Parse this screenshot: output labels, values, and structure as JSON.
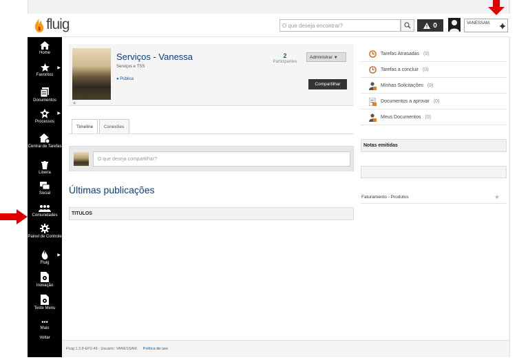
{
  "header": {
    "logo_text": "fluig",
    "search_placeholder": "O que deseja encontrar?",
    "notification_count": "0",
    "user_name": "VANESSAM."
  },
  "sidebar": {
    "items": [
      {
        "label": "Home",
        "icon": "home-icon"
      },
      {
        "label": "Favoritos",
        "icon": "star-icon"
      },
      {
        "label": "Documentos",
        "icon": "documents-icon"
      },
      {
        "label": "Processos",
        "icon": "processes-icon"
      },
      {
        "label": "Central de Tarefas",
        "icon": "tasks-icon"
      },
      {
        "label": "Lixeira",
        "icon": "trash-icon"
      },
      {
        "label": "Social",
        "icon": "social-icon"
      },
      {
        "label": "Comunidades",
        "icon": "communities-icon"
      },
      {
        "label": "Painel de Controle",
        "icon": "gear-icon"
      },
      {
        "label": "Fluig",
        "icon": "fluig-icon"
      },
      {
        "label": "Inovação",
        "icon": "innovation-icon"
      },
      {
        "label": "Teste Menu",
        "icon": "test-menu-icon"
      },
      {
        "label": "Mais",
        "icon": "more-icon"
      },
      {
        "label": "Voltar",
        "icon": "back-icon"
      }
    ]
  },
  "community": {
    "title": "Serviços - Vanessa",
    "subtitle": "Serviços e TSS",
    "visibility": "Pública",
    "participants_count": "2",
    "participants_label": "Participantes",
    "admin_label": "Administrar",
    "share_label": "Compartilhar"
  },
  "tabs": [
    {
      "label": "Timeline"
    },
    {
      "label": "Conexões"
    }
  ],
  "share_placeholder": "O que deseja compartilhar?",
  "recent_title": "Últimas publicações",
  "titles_header": "TITULOS",
  "tasks": [
    {
      "label": "Tarefas Atrasadas",
      "count": "(0)"
    },
    {
      "label": "Tarefas a concluir",
      "count": "(0)"
    },
    {
      "label": "Minhas Solicitações",
      "count": "(0)"
    },
    {
      "label": "Documentos a aprovar",
      "count": "(0)"
    },
    {
      "label": "Meus Documentos",
      "count": "(0)"
    }
  ],
  "notes_header": "Notas emitidas",
  "billing_item": "Faturamento - Produtos",
  "footer": {
    "version": "Fluig 1.3.8-EP2.49 - Usuário: VANESSAM.",
    "policy_link": "Política de uso"
  },
  "colors": {
    "sidebar_bg": "#000000",
    "title_blue": "#0a3d7a",
    "annotation_red": "#e00000"
  }
}
